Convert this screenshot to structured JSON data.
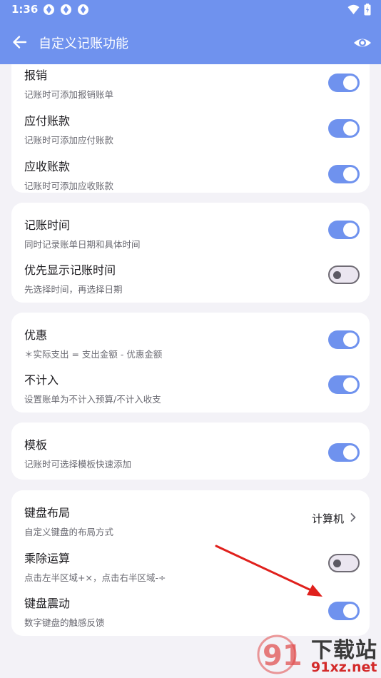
{
  "status_bar": {
    "time": "1:36"
  },
  "app_bar": {
    "title": "自定义记账功能"
  },
  "cards": [
    {
      "rows": [
        {
          "title": "报销",
          "subtitle": "记账时可添加报销账单",
          "toggle": true
        },
        {
          "title": "应付账款",
          "subtitle": "记账时可添加应付账款",
          "toggle": true
        },
        {
          "title": "应收账款",
          "subtitle": "记账时可添加应收账款",
          "toggle": true
        }
      ]
    },
    {
      "rows": [
        {
          "title": "记账时间",
          "subtitle": "同时记录账单日期和具体时间",
          "toggle": true
        },
        {
          "title": "优先显示记账时间",
          "subtitle": "先选择时间，再选择日期",
          "toggle": false
        }
      ]
    },
    {
      "rows": [
        {
          "title": "优惠",
          "subtitle": "＊实际支出 = 支出金额 - 优惠金额",
          "toggle": true
        },
        {
          "title": "不计入",
          "subtitle": "设置账单为不计入预算/不计入收支",
          "toggle": true
        }
      ]
    },
    {
      "rows": [
        {
          "title": "模板",
          "subtitle": "记账时可选择模板快速添加",
          "toggle": true
        }
      ]
    },
    {
      "rows": [
        {
          "title": "键盘布局",
          "subtitle": "自定义键盘的布局方式",
          "value": "计算机"
        },
        {
          "title": "乘除运算",
          "subtitle": "点击左半区域+×，点击右半区域-÷",
          "toggle": false
        },
        {
          "title": "键盘震动",
          "subtitle": "数字键盘的触感反馈",
          "toggle": true
        }
      ]
    }
  ],
  "watermark": {
    "line1": "下载站",
    "line2": "91xz.net"
  },
  "colors": {
    "accent": "#6f92ee",
    "background": "#f3f2f7",
    "annotation_arrow": "#e0201c"
  }
}
